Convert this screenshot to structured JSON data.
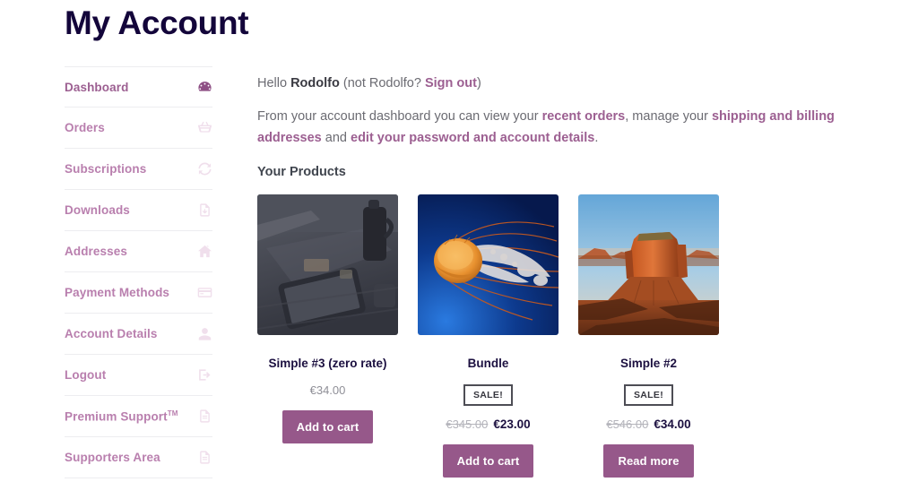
{
  "page": {
    "title": "My Account"
  },
  "sidebar": {
    "items": [
      {
        "label": "Dashboard",
        "icon": "dashboard-gauge-icon",
        "active": true,
        "name": "sidebar-item-dashboard"
      },
      {
        "label": "Orders",
        "icon": "basket-icon",
        "active": false,
        "name": "sidebar-item-orders"
      },
      {
        "label": "Subscriptions",
        "icon": "refresh-icon",
        "active": false,
        "name": "sidebar-item-subscriptions"
      },
      {
        "label": "Downloads",
        "icon": "download-file-icon",
        "active": false,
        "name": "sidebar-item-downloads"
      },
      {
        "label": "Addresses",
        "icon": "home-icon",
        "active": false,
        "name": "sidebar-item-addresses"
      },
      {
        "label": "Payment Methods",
        "icon": "credit-card-icon",
        "active": false,
        "name": "sidebar-item-payment-methods"
      },
      {
        "label": "Account Details",
        "icon": "user-icon",
        "active": false,
        "name": "sidebar-item-account-details"
      },
      {
        "label": "Logout",
        "icon": "logout-arrow-icon",
        "active": false,
        "name": "sidebar-item-logout"
      },
      {
        "label": "Premium Support",
        "suffix": "TM",
        "icon": "document-icon",
        "active": false,
        "name": "sidebar-item-premium-support"
      },
      {
        "label": "Supporters Area",
        "icon": "document-icon",
        "active": false,
        "name": "sidebar-item-supporters-area"
      }
    ]
  },
  "main": {
    "greeting": {
      "hello": "Hello ",
      "username": "Rodolfo",
      "not_prefix": " (not Rodolfo? ",
      "sign_out": "Sign out",
      "not_suffix": ")"
    },
    "intro": {
      "part1": "From your account dashboard you can view your ",
      "link1": "recent orders",
      "part2": ", manage your ",
      "link2": "shipping and billing addresses",
      "part3": " and ",
      "link3": "edit your password and account details",
      "part4": "."
    },
    "products_heading": "Your Products",
    "products": [
      {
        "name": "Simple #3 (zero rate)",
        "image": "desk-tablet-grayscale-photo",
        "on_sale": false,
        "sale_label": "",
        "price_old": "",
        "price": "€34.00",
        "button": "Add to cart"
      },
      {
        "name": "Bundle",
        "image": "jellyfish-blue-photo",
        "on_sale": true,
        "sale_label": "SALE!",
        "price_old": "€345.00",
        "price": "€23.00",
        "button": "Add to cart"
      },
      {
        "name": "Simple #2",
        "image": "monument-valley-butte-photo",
        "on_sale": true,
        "sale_label": "SALE!",
        "price_old": "€546.00",
        "price": "€34.00",
        "button": "Read more"
      }
    ]
  },
  "colors": {
    "title": "#13053a",
    "accent_purple": "#9c5f91",
    "nav_link": "#b97fae",
    "button_bg": "#96588a",
    "body_text": "#6b6b72"
  }
}
